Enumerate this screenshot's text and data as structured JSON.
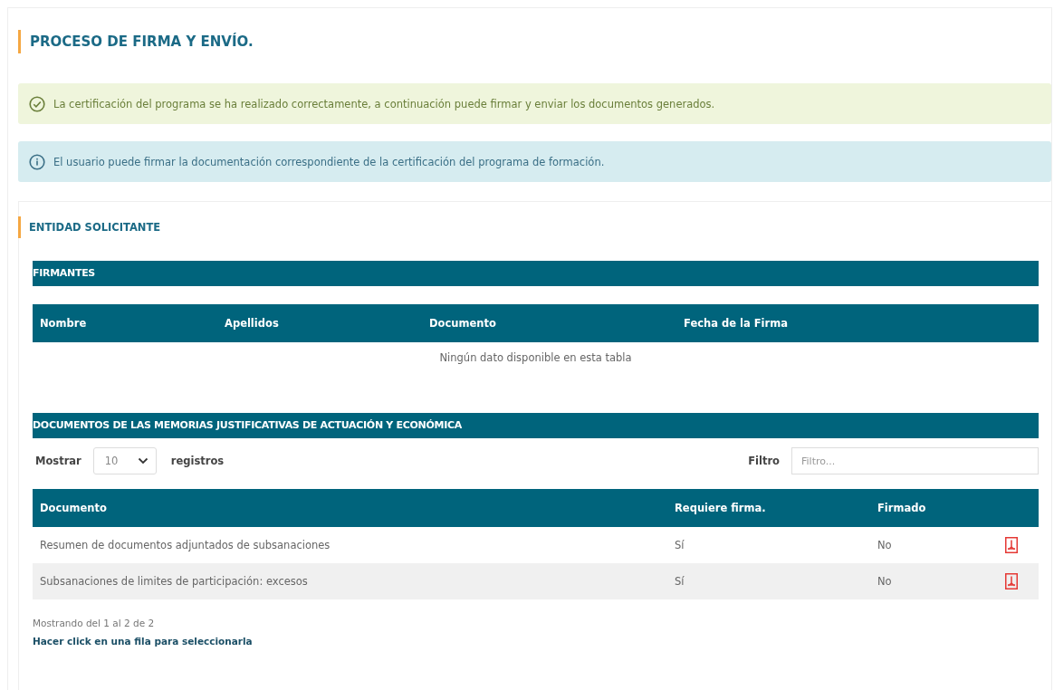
{
  "page_title": "PROCESO DE FIRMA Y ENVÍO.",
  "alerts": [
    {
      "kind": "success",
      "text": "La certificación del programa se ha realizado correctamente, a continuación puede firmar y enviar los documentos generados."
    },
    {
      "kind": "info",
      "text": "El usuario puede firmar la documentación correspondiente de la certificación del programa de formación."
    }
  ],
  "section_title": "ENTIDAD SOLICITANTE",
  "signers": {
    "title": "FIRMANTES",
    "columns": [
      "Nombre",
      "Apellidos",
      "Documento",
      "Fecha de la Firma"
    ],
    "empty_message": "Ningún dato disponible en esta tabla"
  },
  "documents": {
    "title": "DOCUMENTOS DE LAS MEMORIAS JUSTIFICATIVAS DE ACTUACIÓN Y ECONÓMICA",
    "length_label": "Mostrar",
    "length_value": "10",
    "length_suffix": "registros",
    "filter_label": "Filtro",
    "filter_placeholder": "Filtro...",
    "columns": [
      "Documento",
      "Requiere firma.",
      "Firmado"
    ],
    "rows": [
      {
        "document": "Resumen de documentos adjuntados de subsanaciones",
        "requires_signature": "Sí",
        "signed": "No"
      },
      {
        "document": "Subsanaciones de limites de participación: excesos",
        "requires_signature": "Sí",
        "signed": "No"
      }
    ],
    "info": "Mostrando del 1 al 2 de 2",
    "hint": "Hacer click en una fila para seleccionarla"
  }
}
